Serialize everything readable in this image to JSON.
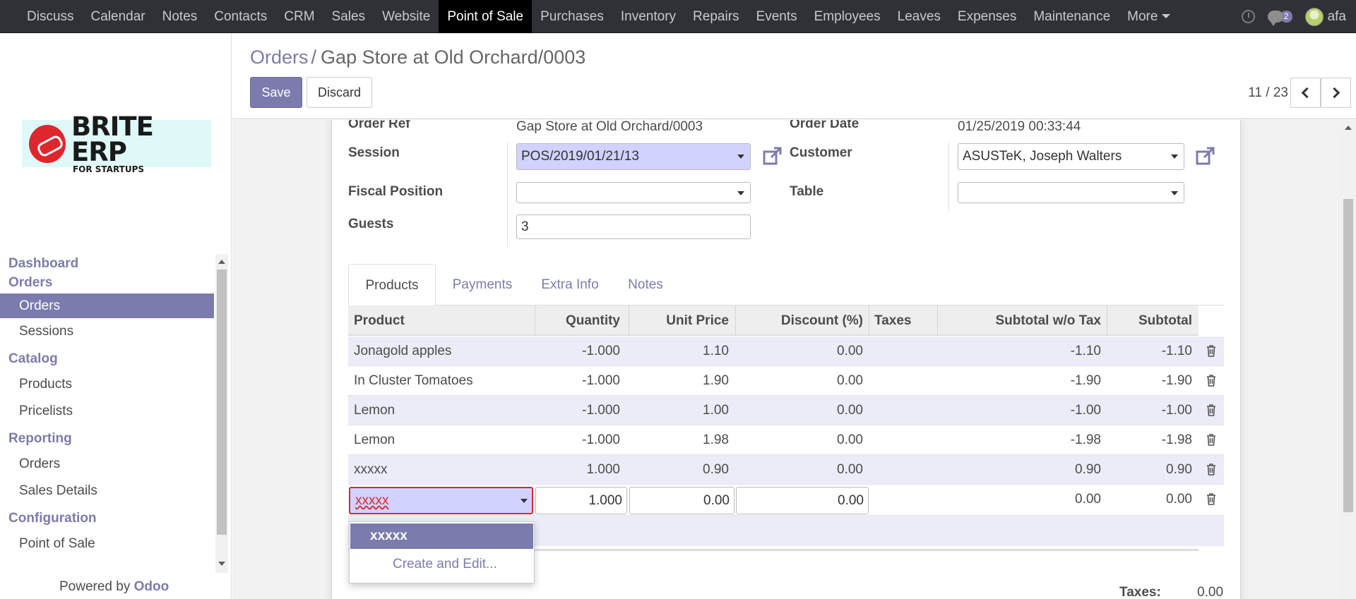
{
  "topbar": {
    "menu": [
      "Discuss",
      "Calendar",
      "Notes",
      "Contacts",
      "CRM",
      "Sales",
      "Website",
      "Point of Sale",
      "Purchases",
      "Inventory",
      "Repairs",
      "Events",
      "Employees",
      "Leaves",
      "Expenses",
      "Maintenance"
    ],
    "active": "Point of Sale",
    "more_label": "More",
    "chat_badge": "2",
    "user_name": "afa"
  },
  "sidebar": {
    "logo_big": "BRITE ERP",
    "logo_small": "FOR STARTUPS",
    "sections": [
      {
        "title": "Dashboard",
        "items": []
      },
      {
        "title": "Orders",
        "items": [
          "Orders",
          "Sessions"
        ]
      },
      {
        "title": "Catalog",
        "items": [
          "Products",
          "Pricelists"
        ]
      },
      {
        "title": "Reporting",
        "items": [
          "Orders",
          "Sales Details"
        ]
      },
      {
        "title": "Configuration",
        "items": [
          "Point of Sale"
        ]
      }
    ],
    "active_item": "Orders",
    "powered_prefix": "Powered by",
    "powered_brand": "Odoo"
  },
  "control": {
    "breadcrumb_parent": "Orders",
    "breadcrumb_sep": "/",
    "breadcrumb_current": "Gap Store at Old Orchard/0003",
    "save_label": "Save",
    "discard_label": "Discard",
    "pager": "11 / 23"
  },
  "form": {
    "order_ref_label": "Order Ref",
    "order_ref": "Gap Store at Old Orchard/0003",
    "session_label": "Session",
    "session": "POS/2019/01/21/13",
    "fiscal_label": "Fiscal Position",
    "fiscal": "",
    "guests_label": "Guests",
    "guests": "3",
    "order_date_label": "Order Date",
    "order_date": "01/25/2019 00:33:44",
    "customer_label": "Customer",
    "customer": "ASUSTeK, Joseph Walters",
    "table_label": "Table",
    "table": ""
  },
  "tabs": [
    "Products",
    "Payments",
    "Extra Info",
    "Notes"
  ],
  "lines": {
    "headers": [
      "Product",
      "Quantity",
      "Unit Price",
      "Discount (%)",
      "Taxes",
      "Subtotal w/o Tax",
      "Subtotal"
    ],
    "rows": [
      {
        "product": "Jonagold apples",
        "qty": "-1.000",
        "price": "1.10",
        "disc": "0.00",
        "taxes": "",
        "sub_wo": "-1.10",
        "sub": "-1.10"
      },
      {
        "product": "In Cluster Tomatoes",
        "qty": "-1.000",
        "price": "1.90",
        "disc": "0.00",
        "taxes": "",
        "sub_wo": "-1.90",
        "sub": "-1.90"
      },
      {
        "product": "Lemon",
        "qty": "-1.000",
        "price": "1.00",
        "disc": "0.00",
        "taxes": "",
        "sub_wo": "-1.00",
        "sub": "-1.00"
      },
      {
        "product": "Lemon",
        "qty": "-1.000",
        "price": "1.98",
        "disc": "0.00",
        "taxes": "",
        "sub_wo": "-1.98",
        "sub": "-1.98"
      },
      {
        "product": "xxxxx",
        "qty": "1.000",
        "price": "0.90",
        "disc": "0.00",
        "taxes": "",
        "sub_wo": "0.90",
        "sub": "0.90"
      }
    ],
    "edit_row": {
      "product": "xxxxx",
      "qty": "1.000",
      "price": "0.00",
      "disc": "0.00",
      "sub_wo": "0.00",
      "sub": "0.00"
    }
  },
  "autocomplete": {
    "match": "xxxxx",
    "create_edit": "Create and Edit..."
  },
  "totals": {
    "taxes_label": "Taxes:",
    "taxes_value": "0.00"
  },
  "colors": {
    "accent": "#7c7bad",
    "navbar": "#2f3136",
    "error": "#e0262d",
    "selected_field": "#d2d2ff"
  }
}
